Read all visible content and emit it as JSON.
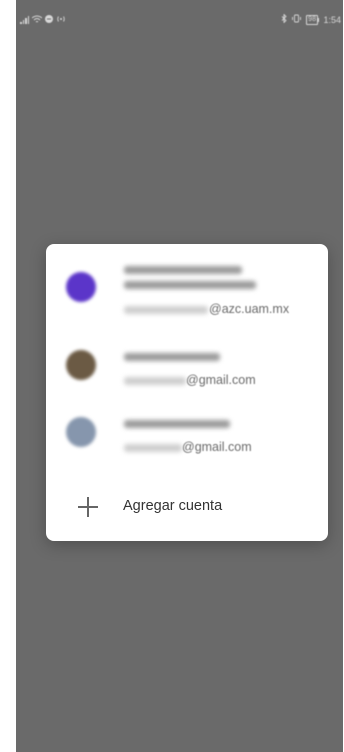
{
  "status_bar": {
    "time": "1:54",
    "battery": "98"
  },
  "accounts": [
    {
      "email_suffix": "@azc.uam.mx",
      "avatar_color": "#5b35c9"
    },
    {
      "email_suffix": "@gmail.com",
      "avatar_color": "#6b5a44"
    },
    {
      "email_suffix": "@gmail.com",
      "avatar_color": "#8696ad"
    }
  ],
  "add_account": {
    "label": "Agregar cuenta"
  },
  "colors": {
    "scrim": "#6a6a6a",
    "dialog": "#ffffff"
  }
}
